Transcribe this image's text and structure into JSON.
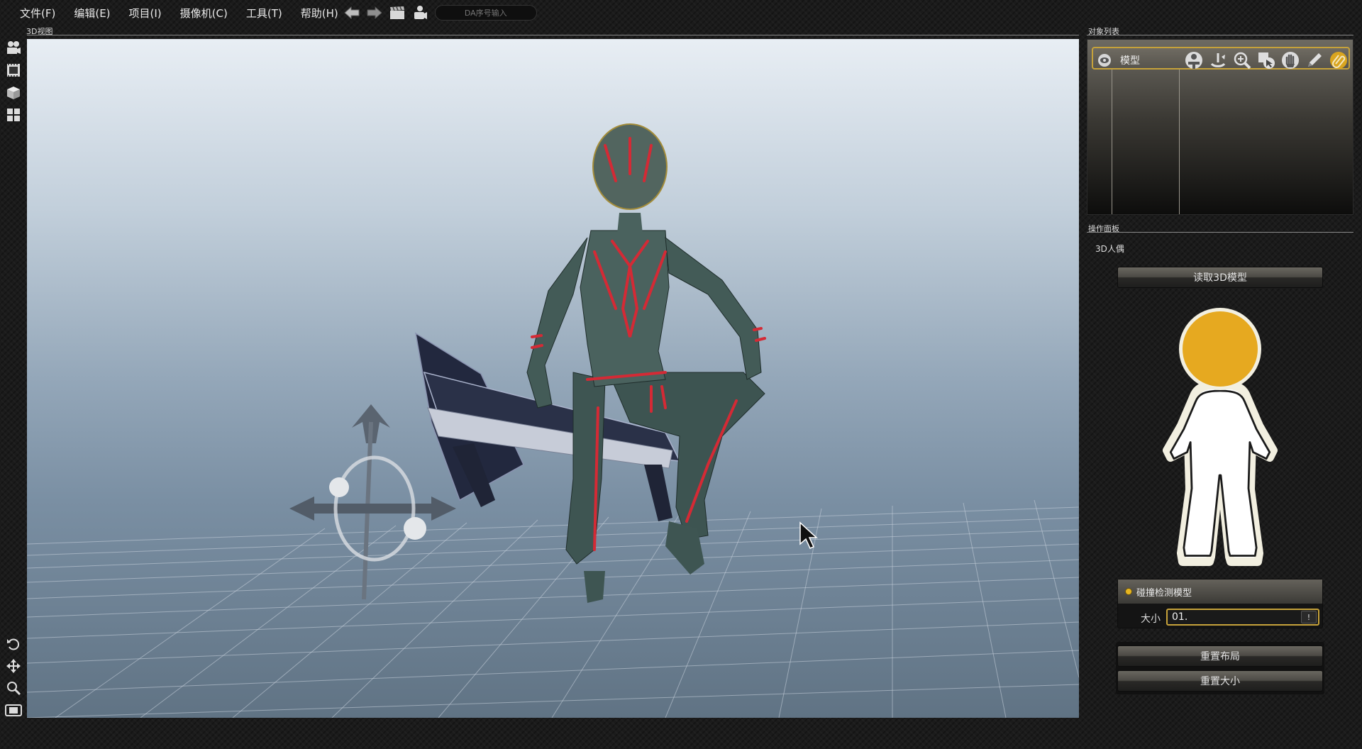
{
  "menu": [
    {
      "label": "文件(F)"
    },
    {
      "label": "编辑(E)"
    },
    {
      "label": "项目(I)"
    },
    {
      "label": "摄像机(C)"
    },
    {
      "label": "工具(T)"
    },
    {
      "label": "帮助(H)"
    }
  ],
  "toolbar": {
    "da_placeholder": "DA序号输入",
    "icons": [
      "back-arrow-icon",
      "forward-arrow-icon",
      "clapperboard-icon",
      "camera-person-icon"
    ]
  },
  "viewport": {
    "label": "3D视图",
    "left_tools": [
      "movie-camera-icon",
      "film-strip-icon",
      "cube-icon",
      "grid-layout-icon"
    ],
    "bottom_tools": [
      "rotate-icon",
      "move-icon",
      "zoom-icon",
      "screenshot-icon"
    ]
  },
  "object_list": {
    "label": "对象列表",
    "row": {
      "name": "模型",
      "icons": [
        "visibility-icon",
        "person-icon",
        "rotate-icon",
        "zoom-icon",
        "select-icon",
        "hand-icon",
        "pencil-icon",
        "attach-icon"
      ]
    }
  },
  "operation_panel": {
    "label": "操作面板",
    "subtitle": "3D人偶",
    "load_button": "读取3D模型",
    "collision": {
      "title": "碰撞检测模型",
      "size_label": "大小",
      "size_value": "01.",
      "size_button": "!"
    },
    "reset_layout": "重置布局",
    "reset_size": "重置大小"
  },
  "colors": {
    "accent": "#c6a23a",
    "figure_head": "#e6a920",
    "figure_outline": "#f2efe0"
  }
}
